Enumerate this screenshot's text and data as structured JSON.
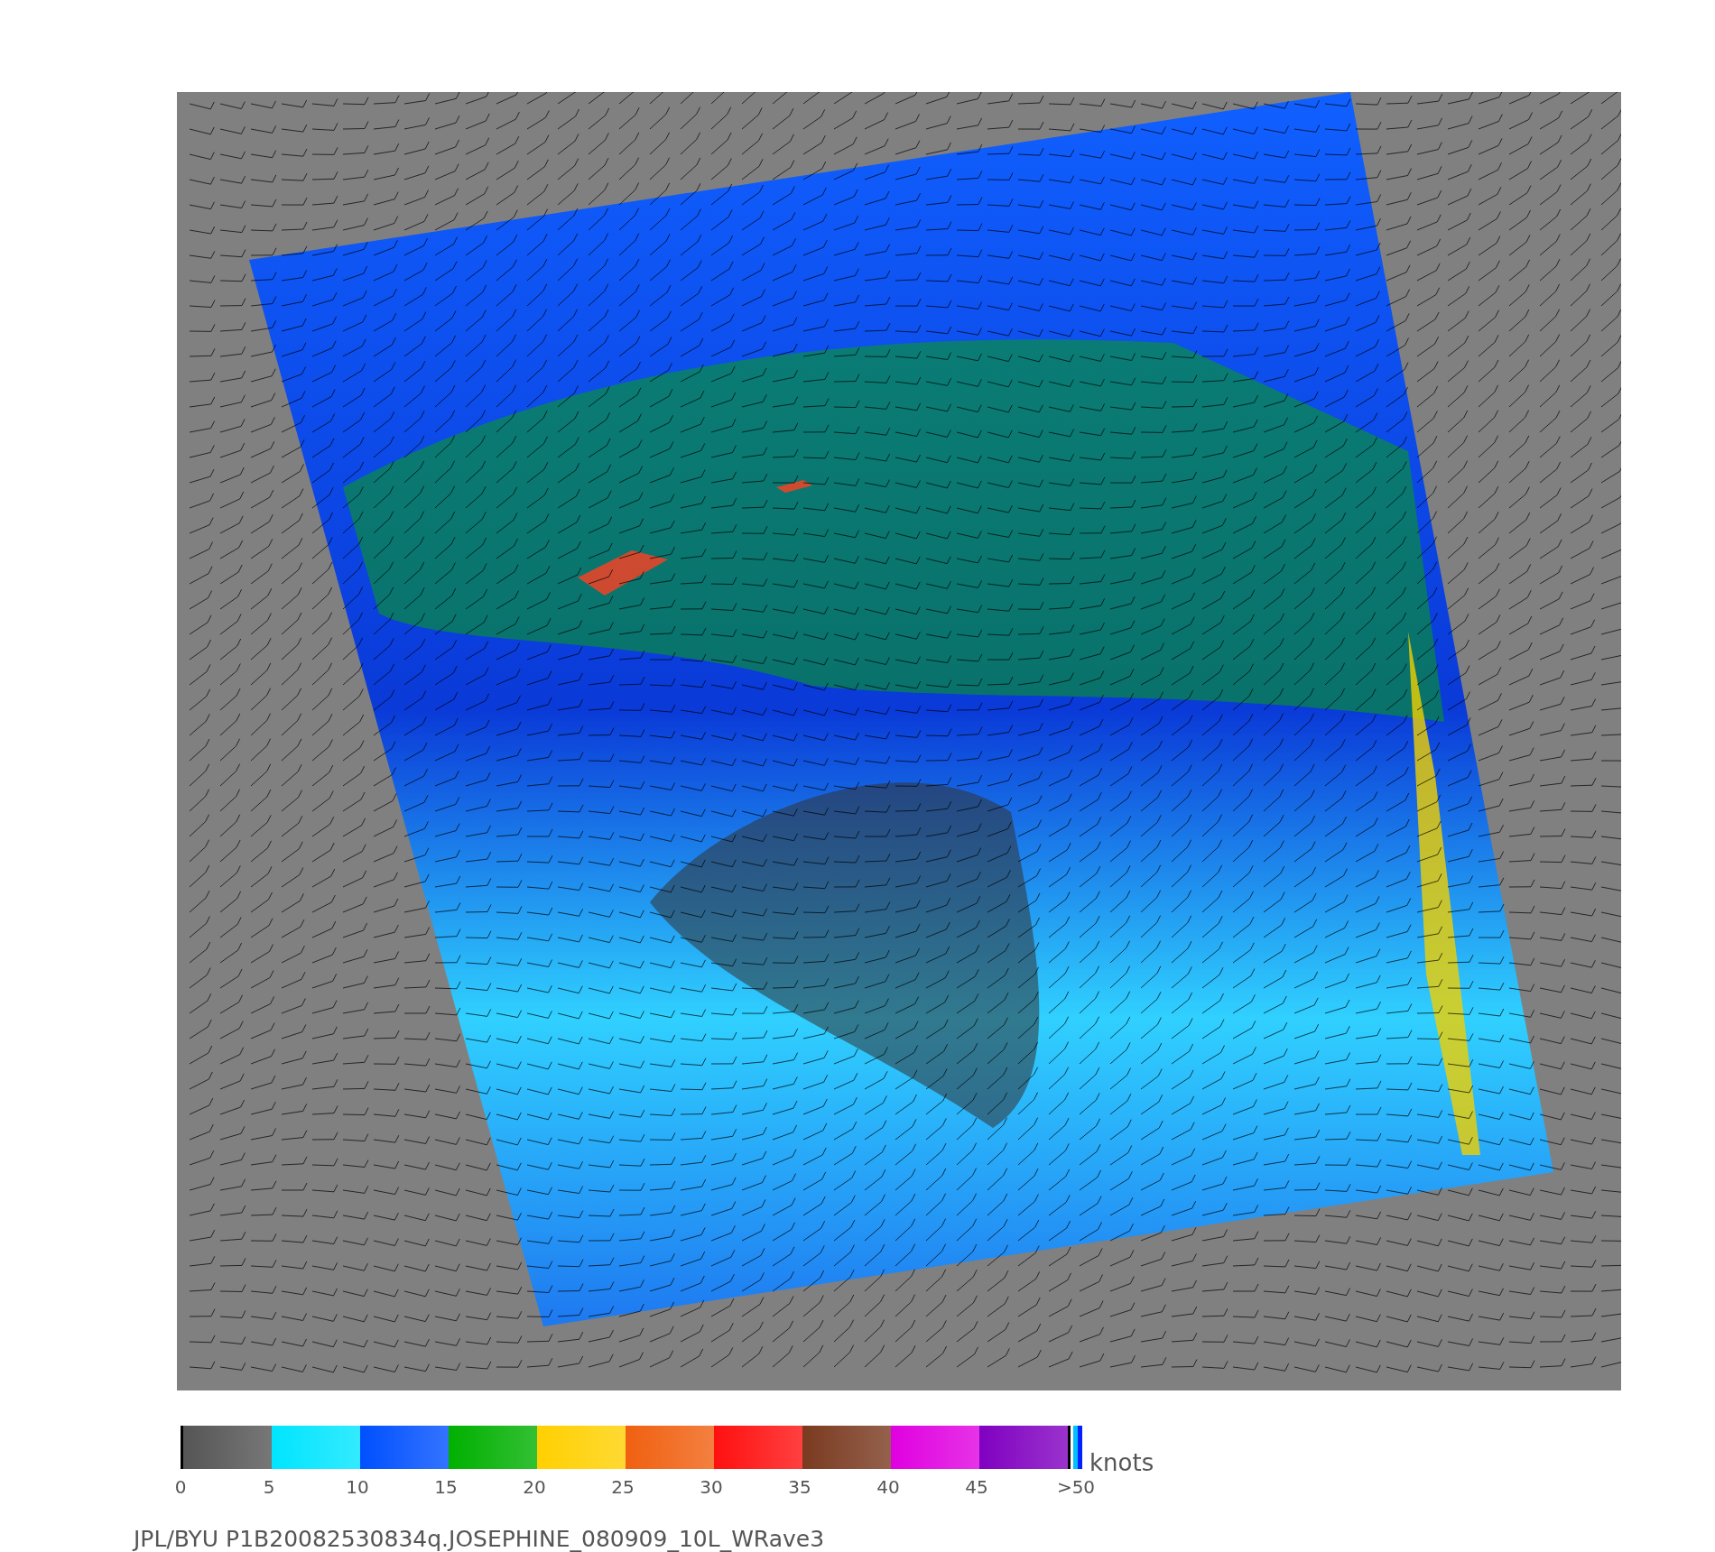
{
  "map": {
    "legend": {
      "unit": "knots",
      "segments": [
        {
          "color": "#555555"
        },
        {
          "color": "#00e5ff"
        },
        {
          "color": "#0050ff"
        },
        {
          "color": "#00b000"
        },
        {
          "color": "#ffd000"
        },
        {
          "color": "#f06010"
        },
        {
          "color": "#ff1010"
        },
        {
          "color": "#7a3a20"
        },
        {
          "color": "#e000e0"
        },
        {
          "color": "#8000c0"
        }
      ],
      "ticks": [
        "0",
        "5",
        "10",
        "15",
        "20",
        "25",
        "30",
        "35",
        "40",
        "45",
        ">50"
      ]
    },
    "caption": "JPL/BYU  P1B20082530834q.JOSEPHINE_080909_10L_WRave3"
  }
}
